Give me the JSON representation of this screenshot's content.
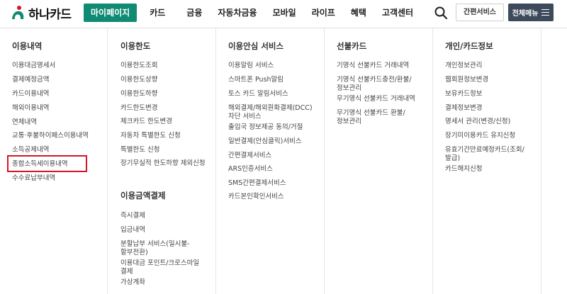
{
  "header": {
    "logo_text": "하나카드",
    "nav": [
      "마이페이지",
      "카드",
      "금융",
      "자동차금융",
      "모바일",
      "라이프",
      "혜택",
      "고객센터"
    ],
    "simple_service": "간편서비스",
    "all_menu": "전체메뉴"
  },
  "colors": {
    "brand_green": "#0f8a73",
    "highlight_red": "#d3172a",
    "dark_button": "#3d4a5c"
  },
  "icons": [
    "hana-logo-icon",
    "search-icon",
    "hamburger-icon"
  ],
  "menu": {
    "col1": {
      "title": "이용내역",
      "items": [
        "이용대금명세서",
        "결제예정금액",
        "카드이용내역",
        "해외이용내역",
        "연체내역",
        "교통·후불하이패스이용내역",
        "소득공제내역",
        "종합소득세이용내역",
        "수수료납부내역"
      ]
    },
    "col2": {
      "title": "이용한도",
      "items": [
        "이용한도조회",
        "이용한도상향",
        "이용한도하향",
        "카드한도변경",
        "체크카드 한도변경",
        "자동차 특별한도 신청",
        "특별한도 신청",
        "장기무실적 한도하향 제외신청"
      ],
      "title2": "이용금액결제",
      "items2": [
        "즉시결제",
        "입금내역",
        "분할납부 서비스(일시불-",
        "할부전환)",
        "이용대금 포인트/크로스마일",
        "결제",
        "가상계좌"
      ]
    },
    "col3": {
      "title": "이용안심 서비스",
      "items": [
        "이용알림 서비스",
        "스마트폰 Push알림",
        "토스 카드 알림서비스",
        "해외결제/해외원화결제(DCC)",
        "차단 서비스",
        "출입국 정보제공 동의/거절",
        "일반결제(안심클릭)서비스",
        "간편결제서비스",
        "ARS인증서비스",
        "SMS간편결제서비스",
        "카드본인확인서비스"
      ]
    },
    "col4": {
      "title": "선불카드",
      "items": [
        "기명식 선불카드 거래내역",
        "기명식 선불카드충전/환불/",
        "정보관리",
        "무기명식 선불카드 거래내역",
        "무기명식 선불카드 환불/",
        "정보관리"
      ]
    },
    "col5": {
      "title": "개인/카드정보",
      "items": [
        "개인정보관리",
        "웹회원정보변경",
        "보유카드정보",
        "결제정보변경",
        "명세서 관리(변경/신청)",
        "장기미이용카드 유지신청",
        "유효기간만료예정카드(조회/",
        "발급)",
        "카드해지신청"
      ]
    }
  }
}
